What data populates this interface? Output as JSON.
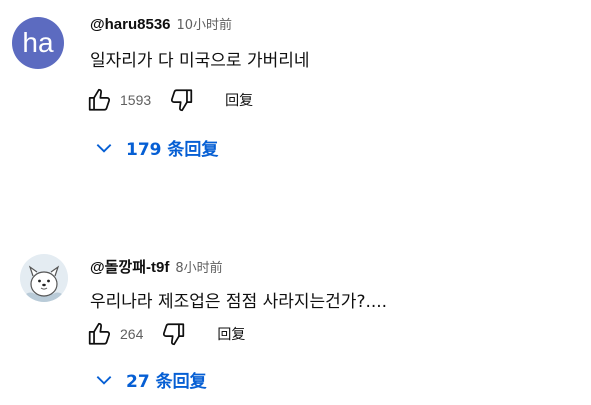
{
  "comments": [
    {
      "avatar_text": "ha",
      "avatar_color": "#5c6bc0",
      "author": "@haru8536",
      "time": "10小时前",
      "text": "일자리가 다 미국으로 가버리네",
      "likes": "1593",
      "reply_label": "回复",
      "replies_label": "179 条回复"
    },
    {
      "avatar_icon": "cartoon-dog-avatar",
      "author": "@돌깡패-t9f",
      "time": "8小时前",
      "text": "우리나라 제조업은 점점 사라지는건가?....",
      "likes": "264",
      "reply_label": "回复",
      "replies_label": "27 条回复"
    }
  ],
  "colors": {
    "link_blue": "#065fd4",
    "secondary_text": "#606060"
  }
}
